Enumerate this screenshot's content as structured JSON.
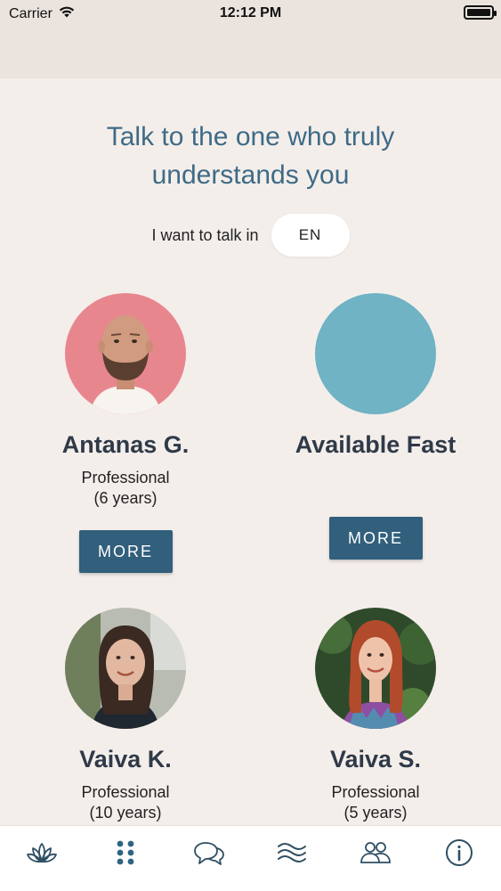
{
  "status_bar": {
    "carrier": "Carrier",
    "time": "12:12 PM",
    "wifi_icon": "wifi-icon",
    "battery_icon": "battery-icon"
  },
  "headline": {
    "line1": "Talk to the one who truly",
    "line2": "understands you"
  },
  "language": {
    "label": "I want to talk in",
    "value": "EN"
  },
  "cards": [
    {
      "name": "Antanas G.",
      "role": "Professional",
      "years": "(6 years)",
      "button": "MORE",
      "avatar": "photo-bald-man-pink-bg"
    },
    {
      "name": "Available Fast",
      "role": "",
      "years": "",
      "button": "MORE",
      "avatar": "teal-circle"
    },
    {
      "name": "Vaiva K.",
      "role": "Professional",
      "years": "(10 years)",
      "avatar": "photo-woman-dark-hair"
    },
    {
      "name": "Vaiva S.",
      "role": "Professional",
      "years": "(5 years)",
      "avatar": "photo-woman-red-hair"
    }
  ],
  "tab_bar": {
    "items": [
      "lotus-icon",
      "grid-dots-icon",
      "chat-bubbles-icon",
      "waves-icon",
      "people-icon",
      "info-icon"
    ],
    "active_index": 1
  },
  "colors": {
    "background": "#f4eeeb",
    "header": "#ebe4de",
    "headline": "#3e6b86",
    "button": "#315f7c",
    "accent_teal": "#6fb3c4",
    "avatar_pink": "#e8868e"
  }
}
